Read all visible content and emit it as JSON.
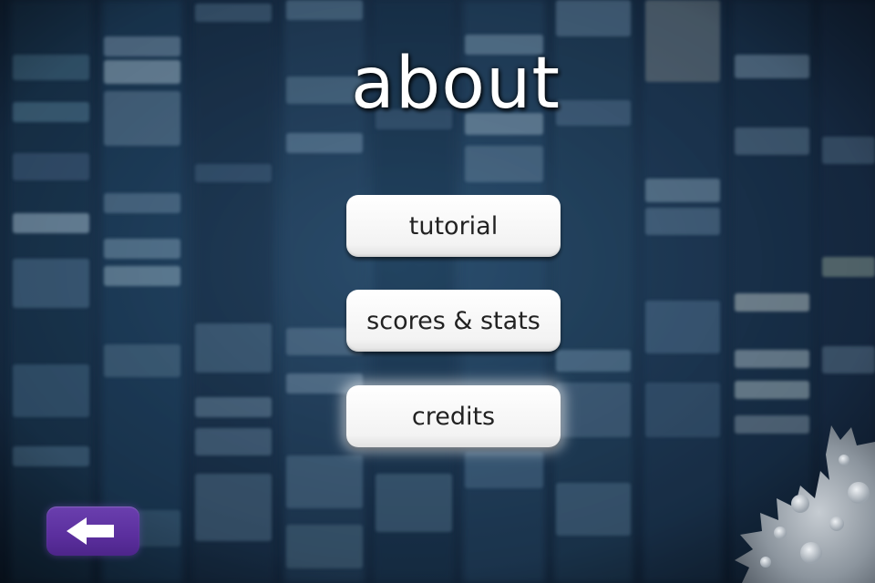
{
  "screen": {
    "title": "about"
  },
  "menu": {
    "tutorial_label": "tutorial",
    "scores_label": "scores & stats",
    "credits_label": "credits",
    "selected": "credits"
  },
  "navigation": {
    "back_icon": "left-arrow-icon"
  },
  "colors": {
    "background": "#1c3652",
    "button_face": "#ffffff",
    "button_text": "#222222",
    "back_button": "#5b2f9e",
    "title_text": "#ffffff"
  }
}
